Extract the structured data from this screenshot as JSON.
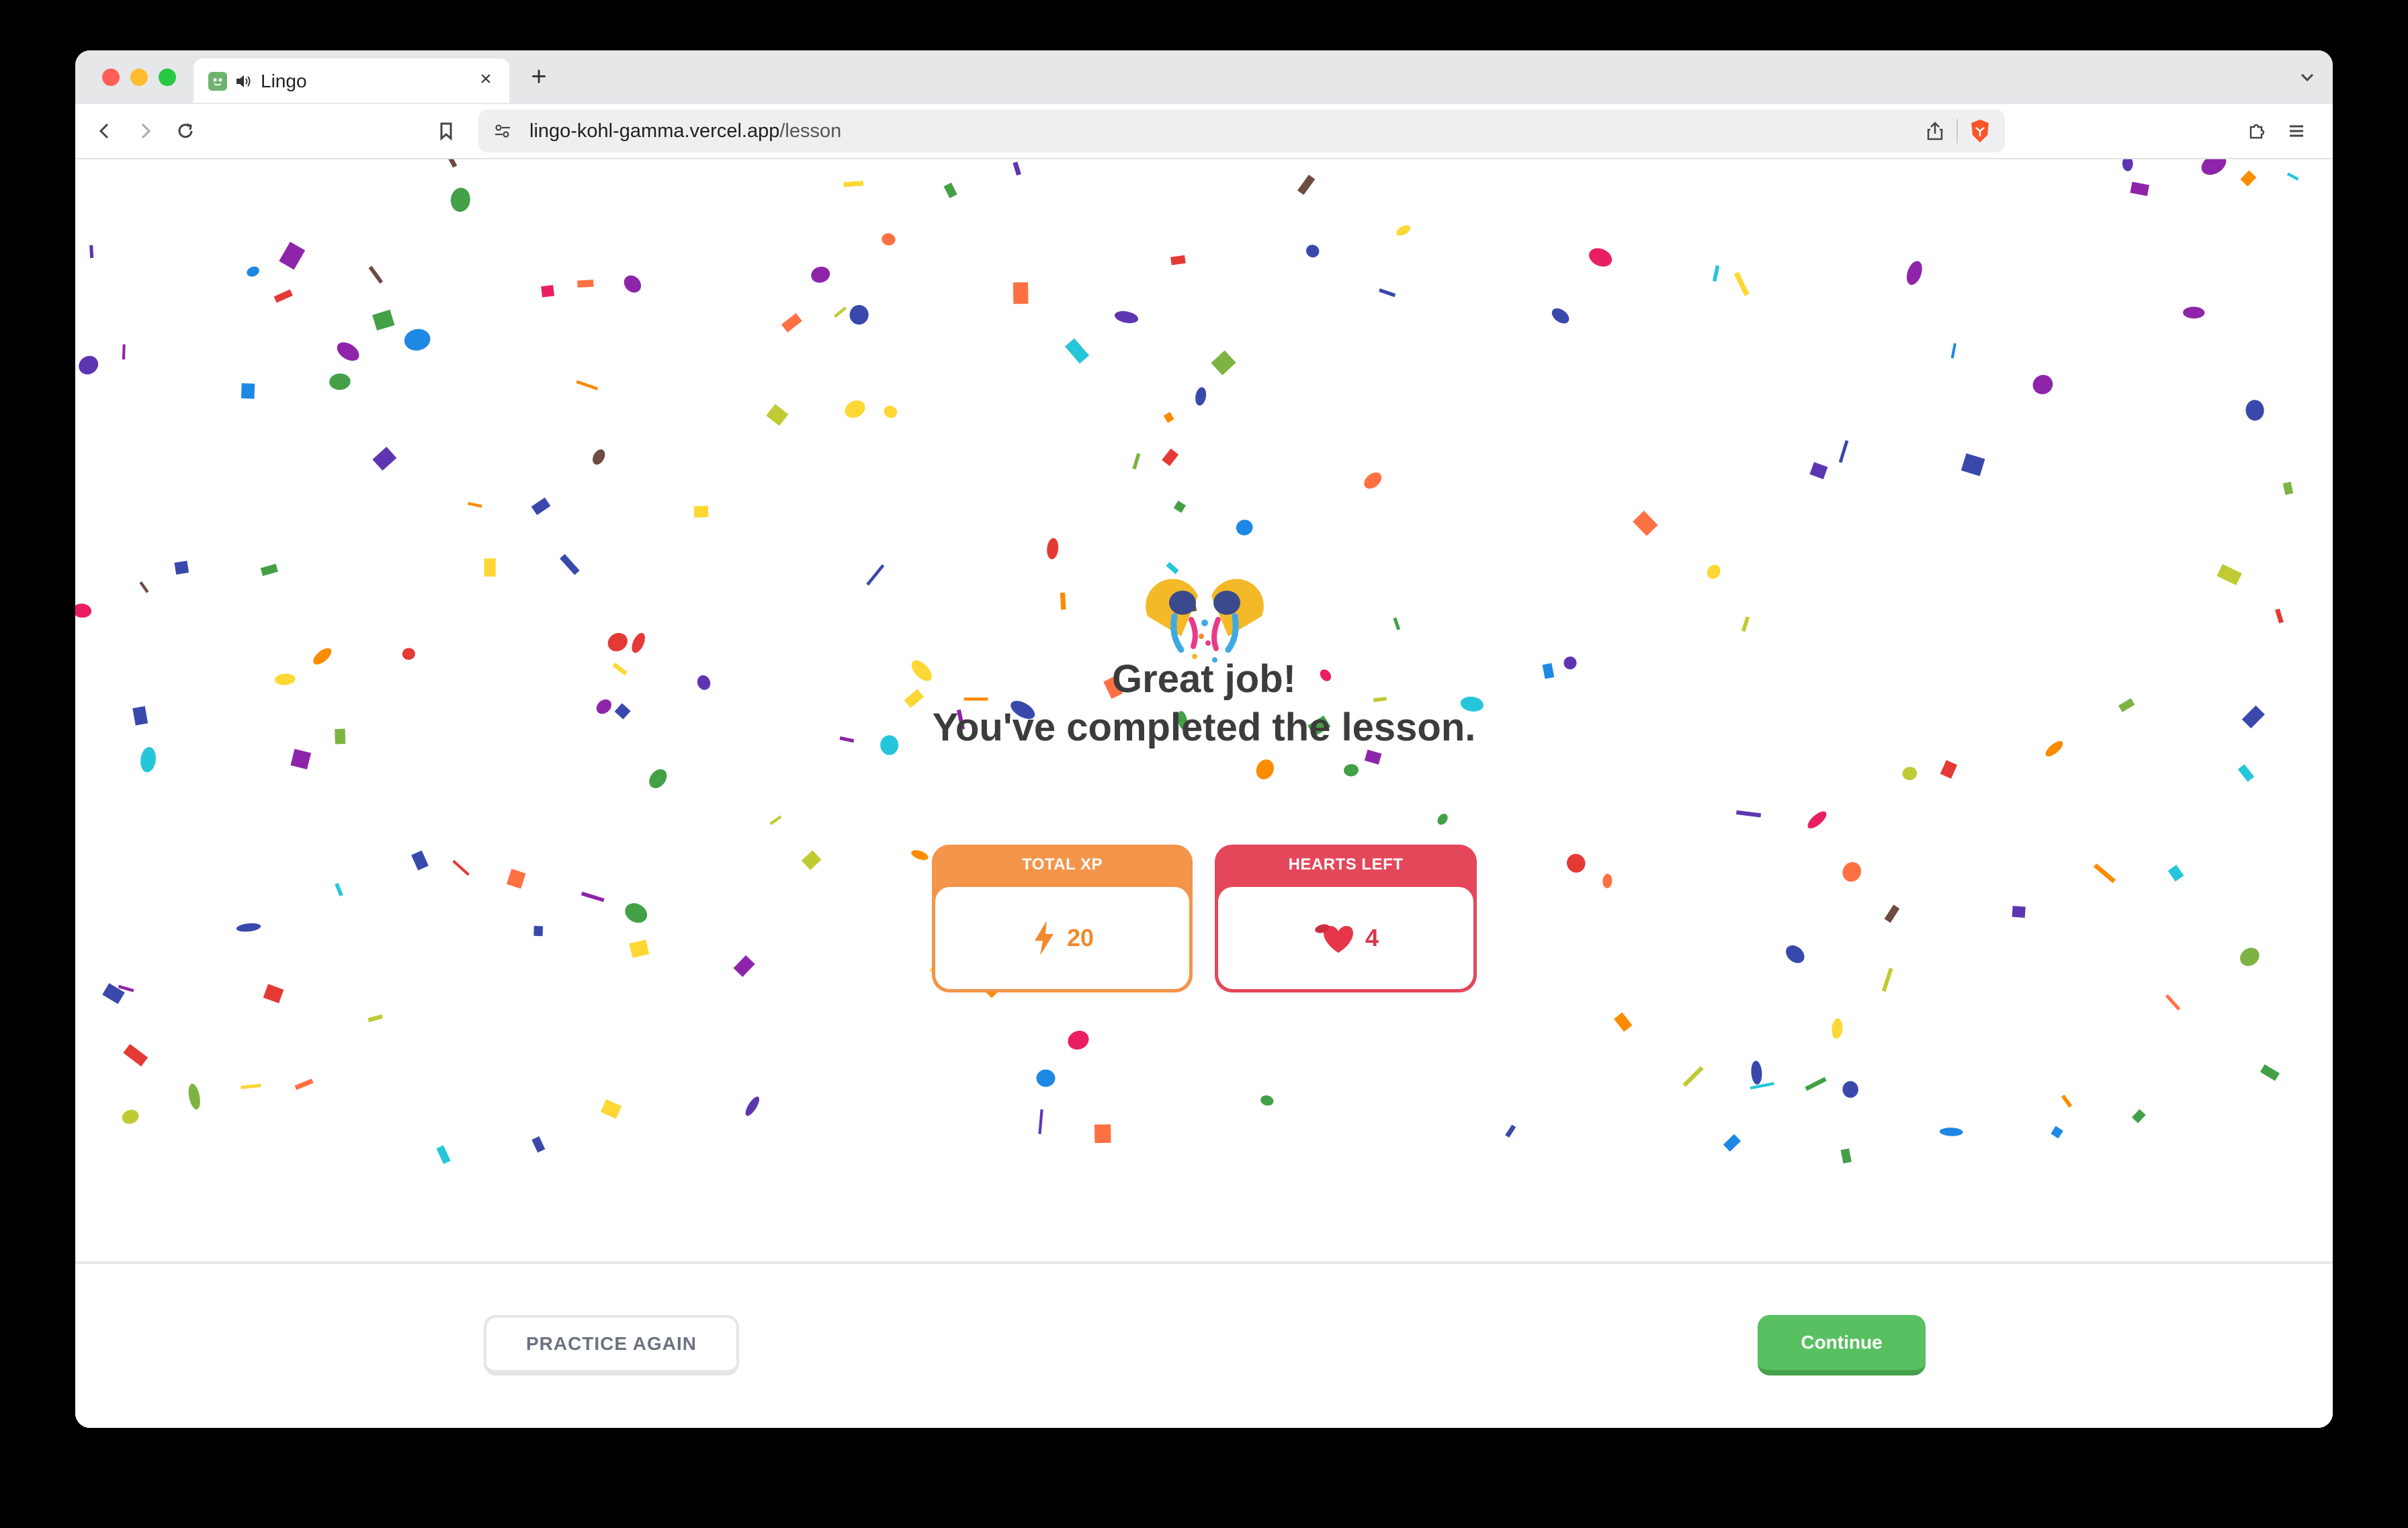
{
  "browser": {
    "tab_title": "Lingo",
    "tab_close": "×",
    "new_tab": "+",
    "url_domain": "lingo-kohl-gamma.vercel.app",
    "url_path": "/lesson"
  },
  "lesson_complete": {
    "title_line1": "Great job!",
    "title_line2": "You've completed the lesson.",
    "xp_card": {
      "label": "TOTAL XP",
      "value": "20",
      "color": "#f3954a"
    },
    "hearts_card": {
      "label": "HEARTS LEFT",
      "value": "4",
      "color": "#e5475a"
    }
  },
  "footer": {
    "practice_again_label": "PRACTICE AGAIN",
    "continue_label": "Continue",
    "continue_color": "#58c061"
  }
}
